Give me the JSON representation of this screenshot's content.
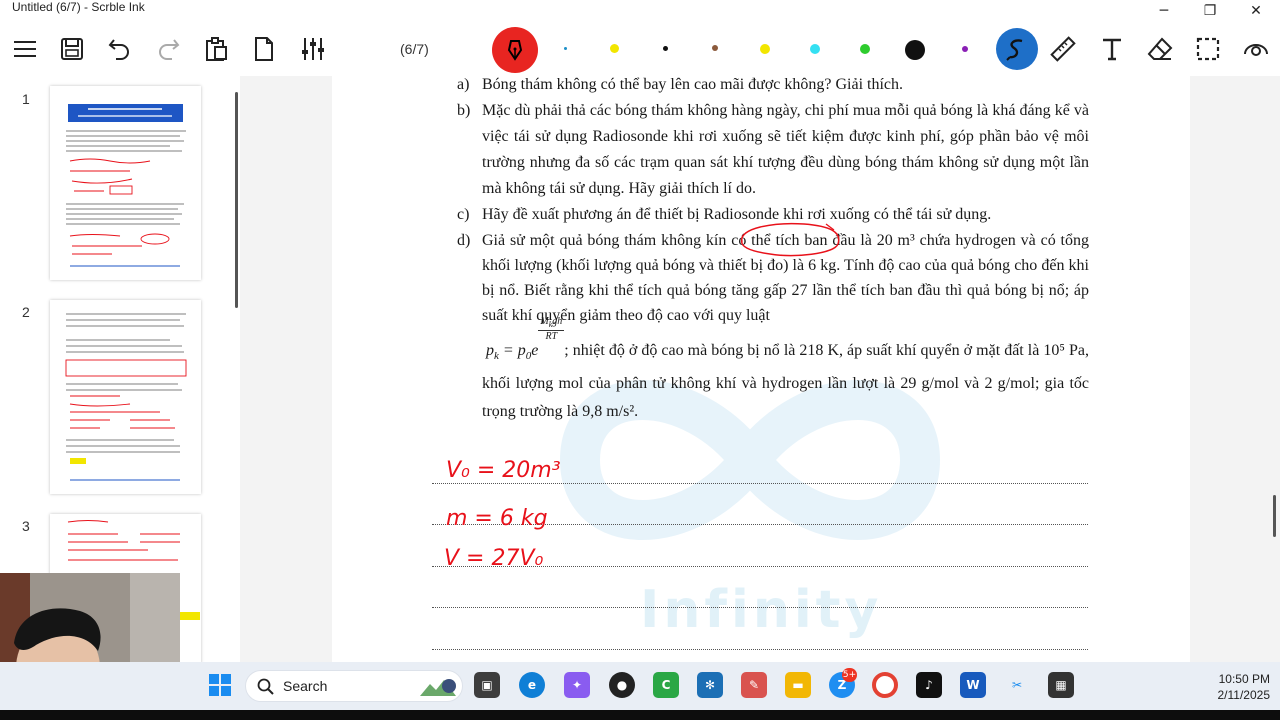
{
  "window": {
    "title": "Untitled (6/7) - Scrble Ink",
    "minimize": "─",
    "restore": "❐",
    "close": "✕"
  },
  "toolbar": {
    "page_indicator": "(6/7)",
    "colors": {
      "pen_red": "#e82521",
      "yellow": "#f2e600",
      "black": "#111111",
      "brown": "#8b5a3c",
      "cyan": "#34e0f2",
      "green": "#2ecc2e",
      "purple": "#8a1fb5",
      "blue_tool": "#1e6fc8",
      "small_blue": "#1e90c8"
    },
    "icons": [
      "menu-icon",
      "save-icon",
      "undo-icon",
      "redo-icon",
      "clipboard-icon",
      "new-page-icon",
      "settings-sliders-icon",
      "pen-icon",
      "lasso-icon",
      "ruler-icon",
      "text-tool-icon",
      "eraser-icon",
      "select-icon",
      "view-icon"
    ]
  },
  "sidebar": {
    "thumbnails": [
      {
        "number": "1"
      },
      {
        "number": "2"
      },
      {
        "number": "3"
      }
    ]
  },
  "document": {
    "items": {
      "a": {
        "label": "a)",
        "text": "Bóng thám không có thể bay lên cao mãi được không? Giải thích."
      },
      "b": {
        "label": "b)",
        "text": "Mặc dù phải thả các bóng thám không hàng ngày, chi phí mua mỗi quả bóng là khá đáng kể và việc tái sử dụng Radiosonde khi rơi xuống sẽ tiết kiệm được kinh phí, góp phần bảo vệ môi trường nhưng đa số các trạm quan sát khí tượng đều dùng bóng thám không sử dụng một lần mà không tái sử dụng. Hãy giải thích lí do."
      },
      "c": {
        "label": "c)",
        "text_before": "Hãy đề xuất phương án để thiết bị ",
        "highlight": "Radiosonde",
        "text_after": " khi rơi xuống có thể tái sử dụng."
      },
      "d": {
        "label": "d)",
        "text1": "Giả sử một quả bóng thám không kín có thể tích ban đầu là 20 m³ chứa hydrogen và có tổng khối lượng (khối lượng quả bóng và thiết bị đo) là 6 kg. Tính độ cao của quả bóng cho đến khi bị nổ. Biết rằng khi thể tích quả bóng tăng gấp 27 lần thể tích ban đầu thì quả bóng bị nổ; áp suất khí quyển giảm theo độ cao với quy luật",
        "formula_lhs": "p",
        "formula_lhs_sub": "k",
        "formula_eq": " = p",
        "formula_p0_sub": "0",
        "formula_e": "e",
        "formula_exp_num": "M",
        "formula_exp_num_sub": "k",
        "formula_exp_num_rest": "gh",
        "formula_exp_den": "RT",
        "text2": "; nhiệt độ ở độ cao mà bóng bị nổ là 218 K, áp suất khí quyển ở mặt đất là 10⁵ Pa, khối lượng mol của phân tử không khí và hydrogen lần lượt là 29 g/mol và 2 g/mol; gia tốc trọng trường là 9,8 m/s²."
      }
    },
    "handwriting": {
      "line1": "V₀ = 20m³",
      "line2": "m = 6 kg",
      "line3": "V = 27V₀"
    },
    "watermark": "Infinity"
  },
  "taskbar": {
    "search_label": "Search",
    "time": "10:50 PM",
    "date": "2/11/2025",
    "badge_zalo": "5+"
  }
}
